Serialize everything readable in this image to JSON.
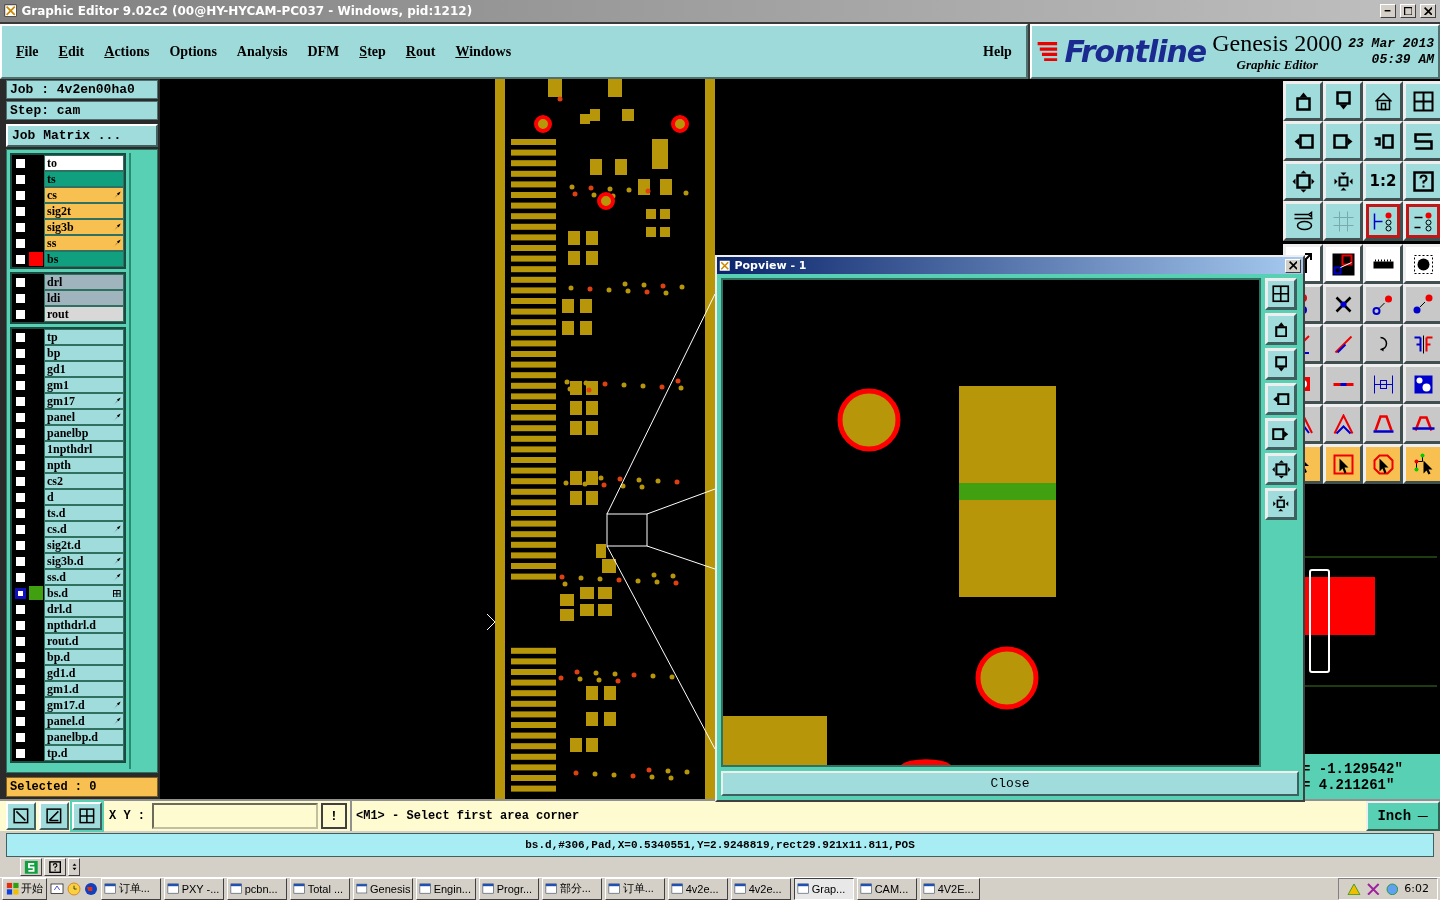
{
  "window": {
    "title": "Graphic Editor 9.02c2 (00@HY-HYCAM-PC037 - Windows, pid:1212)"
  },
  "menu": [
    {
      "label": "File",
      "mnemonic": true
    },
    {
      "label": "Edit",
      "mnemonic": true
    },
    {
      "label": "Actions",
      "mnemonic": true
    },
    {
      "label": "Options",
      "mnemonic": false
    },
    {
      "label": "Analysis",
      "mnemonic": false
    },
    {
      "label": "DFM",
      "mnemonic": false
    },
    {
      "label": "Step",
      "mnemonic": true
    },
    {
      "label": "Rout",
      "mnemonic": true
    },
    {
      "label": "Windows",
      "mnemonic": true
    }
  ],
  "help": "Help",
  "brand": {
    "logo": "Frontline",
    "product": "Genesis 2000",
    "subtitle": "Graphic Editor",
    "date": "23 Mar 2013",
    "time": "05:39 AM"
  },
  "job": "Job : 4v2en00ha0",
  "step": "Step: cam",
  "job_matrix": "Job Matrix ...",
  "layer_groups": [
    {
      "layers": [
        {
          "name": "to",
          "kind": "silk",
          "selected": false,
          "arrow": false
        },
        {
          "name": "ts",
          "kind": "mask",
          "selected": false,
          "arrow": false
        },
        {
          "name": "cs",
          "kind": "signal",
          "selected": false,
          "arrow": true
        },
        {
          "name": "sig2t",
          "kind": "signal",
          "selected": false,
          "arrow": false
        },
        {
          "name": "sig3b",
          "kind": "signal",
          "selected": false,
          "arrow": true
        },
        {
          "name": "ss",
          "kind": "signal",
          "selected": false,
          "arrow": true
        },
        {
          "name": "bs",
          "kind": "mask",
          "selected": false,
          "arrow": false,
          "color": "#ff0000"
        }
      ]
    },
    {
      "layers": [
        {
          "name": "drl",
          "kind": "drill",
          "selected": false,
          "arrow": false
        },
        {
          "name": "ldi",
          "kind": "drill",
          "selected": false,
          "arrow": false
        },
        {
          "name": "rout",
          "kind": "rout",
          "selected": false,
          "arrow": false
        }
      ]
    },
    {
      "layers": [
        {
          "name": "tp",
          "kind": "misc",
          "selected": false,
          "arrow": false
        },
        {
          "name": "bp",
          "kind": "misc",
          "selected": false,
          "arrow": false
        },
        {
          "name": "gd1",
          "kind": "misc",
          "selected": false,
          "arrow": false
        },
        {
          "name": "gm1",
          "kind": "misc",
          "selected": false,
          "arrow": false
        },
        {
          "name": "gm17",
          "kind": "misc",
          "selected": false,
          "arrow": true
        },
        {
          "name": "panel",
          "kind": "misc",
          "selected": false,
          "arrow": true
        },
        {
          "name": "panelbp",
          "kind": "misc",
          "selected": false,
          "arrow": false
        },
        {
          "name": "1npthdrl",
          "kind": "misc",
          "selected": false,
          "arrow": false
        },
        {
          "name": "npth",
          "kind": "misc",
          "selected": false,
          "arrow": false
        },
        {
          "name": "cs2",
          "kind": "misc",
          "selected": false,
          "arrow": false
        },
        {
          "name": "d",
          "kind": "misc",
          "selected": false,
          "arrow": false
        },
        {
          "name": "ts.d",
          "kind": "misc",
          "selected": false,
          "arrow": false
        },
        {
          "name": "cs.d",
          "kind": "misc",
          "selected": false,
          "arrow": true
        },
        {
          "name": "sig2t.d",
          "kind": "misc",
          "selected": false,
          "arrow": false
        },
        {
          "name": "sig3b.d",
          "kind": "misc",
          "selected": false,
          "arrow": true
        },
        {
          "name": "ss.d",
          "kind": "misc",
          "selected": false,
          "arrow": true
        },
        {
          "name": "bs.d",
          "kind": "misc",
          "selected": true,
          "arrow": false,
          "grid_marker": true,
          "color": "#40a010"
        },
        {
          "name": "drl.d",
          "kind": "misc",
          "selected": false,
          "arrow": false
        },
        {
          "name": "npthdrl.d",
          "kind": "misc",
          "selected": false,
          "arrow": false
        },
        {
          "name": "rout.d",
          "kind": "misc",
          "selected": false,
          "arrow": false
        },
        {
          "name": "bp.d",
          "kind": "misc",
          "selected": false,
          "arrow": false
        },
        {
          "name": "gd1.d",
          "kind": "misc",
          "selected": false,
          "arrow": false
        },
        {
          "name": "gm1.d",
          "kind": "misc",
          "selected": false,
          "arrow": false
        },
        {
          "name": "gm17.d",
          "kind": "misc",
          "selected": false,
          "arrow": true
        },
        {
          "name": "panel.d",
          "kind": "misc",
          "selected": false,
          "arrow": true
        },
        {
          "name": "panelbp.d",
          "kind": "misc",
          "selected": false,
          "arrow": false
        },
        {
          "name": "tp.d",
          "kind": "misc",
          "selected": false,
          "arrow": false
        }
      ]
    }
  ],
  "selected_count": "Selected : 0",
  "toolbar_rows": [
    {
      "kind": "view",
      "buttons": [
        {
          "selected": false
        },
        {
          "selected": false
        },
        {
          "selected": false
        },
        {
          "selected": false
        }
      ]
    },
    {
      "kind": "view",
      "buttons": [
        {
          "selected": false
        },
        {
          "selected": false
        },
        {
          "selected": false
        },
        {
          "selected": false
        }
      ]
    },
    {
      "kind": "view",
      "buttons": [
        {
          "selected": false
        },
        {
          "selected": false
        },
        {
          "selected": false,
          "label": "1:2"
        },
        {
          "selected": false
        }
      ]
    },
    {
      "kind": "view",
      "buttons": [
        {
          "selected": false
        },
        {
          "selected": false
        },
        {
          "selected": true
        },
        {
          "selected": true
        }
      ]
    },
    {
      "kind": "display",
      "buttons": [
        {
          "selected": false
        },
        {
          "selected": false
        },
        {
          "selected": false
        },
        {
          "selected": false
        }
      ]
    },
    {
      "kind": "edit",
      "buttons": [
        {
          "selected": false
        },
        {
          "selected": false
        },
        {
          "selected": false
        },
        {
          "selected": false
        }
      ]
    },
    {
      "kind": "edit",
      "buttons": [
        {
          "selected": false
        },
        {
          "selected": false
        },
        {
          "selected": false
        },
        {
          "selected": false
        }
      ]
    },
    {
      "kind": "edit",
      "buttons": [
        {
          "selected": false
        },
        {
          "selected": false
        },
        {
          "selected": false
        },
        {
          "selected": false
        }
      ]
    },
    {
      "kind": "edit",
      "buttons": [
        {
          "selected": false
        },
        {
          "selected": false
        },
        {
          "selected": false
        },
        {
          "selected": false
        }
      ]
    },
    {
      "kind": "select",
      "buttons": [
        {
          "selected": false
        },
        {
          "selected": false
        },
        {
          "selected": false
        },
        {
          "selected": false
        }
      ]
    }
  ],
  "readout": {
    "x": "= -1.129542\"",
    "y": "= 4.211261\""
  },
  "popview": {
    "title": "Popview - 1",
    "close": "Close"
  },
  "command": {
    "xy_label": "X Y :",
    "bang": "!",
    "prompt": "<M1> - Select first area corner",
    "units": "Inch"
  },
  "info": "bs.d,#306,Pad,X=0.5340551,Y=2.9248819,rect29.921x11.811,POS",
  "taskbar": {
    "start": "开始",
    "tasks": [
      {
        "label": "订单...",
        "selected": false
      },
      {
        "label": "PXY -...",
        "selected": false
      },
      {
        "label": "pcbn...",
        "selected": false
      },
      {
        "label": "Total ...",
        "selected": false
      },
      {
        "label": "Genesis",
        "selected": false
      },
      {
        "label": "Engin...",
        "selected": false
      },
      {
        "label": "Progr...",
        "selected": false
      },
      {
        "label": "部分...",
        "selected": false
      },
      {
        "label": "订单...",
        "selected": false
      },
      {
        "label": "4v2e...",
        "selected": false
      },
      {
        "label": "4v2e...",
        "selected": false
      },
      {
        "label": "Grap...",
        "selected": true
      },
      {
        "label": "CAM...",
        "selected": false
      },
      {
        "label": "4V2E...",
        "selected": false
      }
    ],
    "clock": "6:02"
  }
}
